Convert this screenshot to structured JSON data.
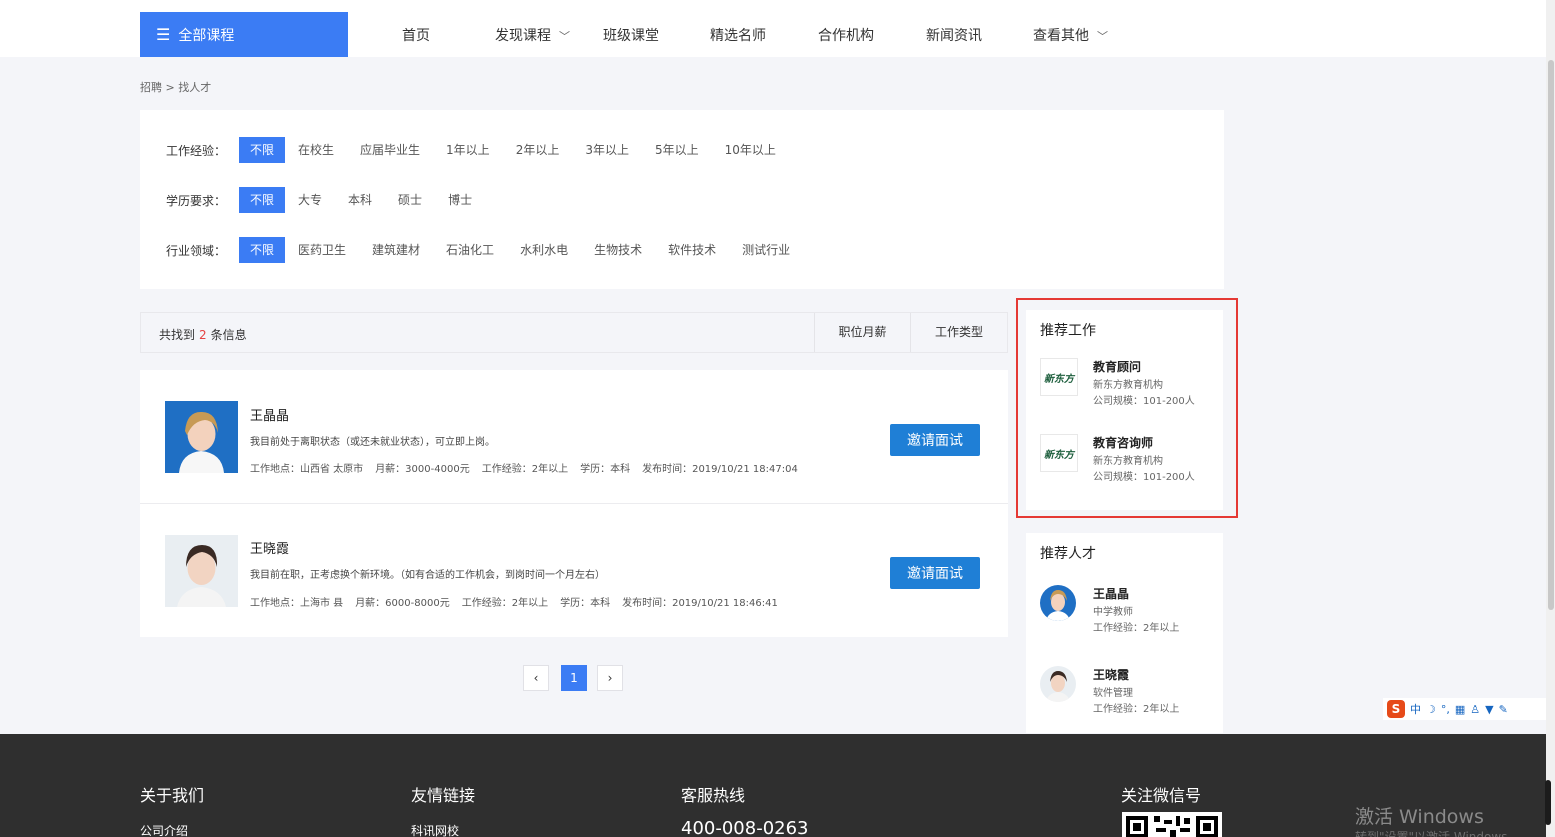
{
  "nav": {
    "all_courses": "全部课程",
    "items": [
      {
        "label": "首页",
        "has_menu": false
      },
      {
        "label": "发现课程",
        "has_menu": true
      },
      {
        "label": "班级课堂",
        "has_menu": false
      },
      {
        "label": "精选名师",
        "has_menu": false
      },
      {
        "label": "合作机构",
        "has_menu": false
      },
      {
        "label": "新闻资讯",
        "has_menu": false
      },
      {
        "label": "查看其他",
        "has_menu": true
      }
    ]
  },
  "breadcrumb": "招聘 > 找人才",
  "filters": {
    "experience": {
      "label": "工作经验：",
      "options": [
        "不限",
        "在校生",
        "应届毕业生",
        "1年以上",
        "2年以上",
        "3年以上",
        "5年以上",
        "10年以上"
      ]
    },
    "education": {
      "label": "学历要求：",
      "options": [
        "不限",
        "大专",
        "本科",
        "硕士",
        "博士"
      ]
    },
    "industry": {
      "label": "行业领域：",
      "options": [
        "不限",
        "医药卫生",
        "建筑建材",
        "石油化工",
        "水利水电",
        "生物技术",
        "软件技术",
        "测试行业"
      ]
    }
  },
  "results": {
    "prefix": "共找到",
    "count": "2",
    "suffix": "条信息",
    "sort_salary": "职位月薪",
    "sort_type": "工作类型"
  },
  "candidates": [
    {
      "name": "王晶晶",
      "desc": "我目前处于离职状态（或还未就业状态），可立即上岗。",
      "location": "工作地点：山西省 太原市",
      "salary": "月薪：3000-4000元",
      "experience": "工作经验：2年以上",
      "education": "学历：本科",
      "published": "发布时间：2019/10/21 18:47:04",
      "button": "邀请面试"
    },
    {
      "name": "王晓霞",
      "desc": "我目前在职，正考虑换个新环境。（如有合适的工作机会，到岗时间一个月左右）",
      "location": "工作地点：上海市 县",
      "salary": "月薪：6000-8000元",
      "experience": "工作经验：2年以上",
      "education": "学历：本科",
      "published": "发布时间：2019/10/21 18:46:41",
      "button": "邀请面试"
    }
  ],
  "pagination": {
    "prev": "‹",
    "current": "1",
    "next": "›"
  },
  "recommended_jobs": {
    "title": "推荐工作",
    "items": [
      {
        "logo": "新东方",
        "title": "教育顾问",
        "company": "新东方教育机构",
        "size": "公司规模：101-200人"
      },
      {
        "logo": "新东方",
        "title": "教育咨询师",
        "company": "新东方教育机构",
        "size": "公司规模：101-200人"
      }
    ]
  },
  "recommended_talent": {
    "title": "推荐人才",
    "items": [
      {
        "name": "王晶晶",
        "role": "中学教师",
        "experience": "工作经验：2年以上"
      },
      {
        "name": "王晓霞",
        "role": "软件管理",
        "experience": "工作经验：2年以上"
      }
    ]
  },
  "footer": {
    "about": "关于我们",
    "about_link": "公司介绍",
    "friends": "友情链接",
    "friends_link": "科讯网校",
    "hotline_title": "客服热线",
    "hotline": "400-008-0263",
    "wechat": "关注微信号"
  },
  "windows": {
    "activate": "激活 Windows",
    "activate_hint": "转到\"设置\"以激活 Windows"
  },
  "ime": {
    "mode": "中"
  },
  "colors": {
    "primary": "#3b7cf4",
    "invite": "#1f7fd6",
    "highlight": "#e53935",
    "footer": "#2f2f2f"
  }
}
